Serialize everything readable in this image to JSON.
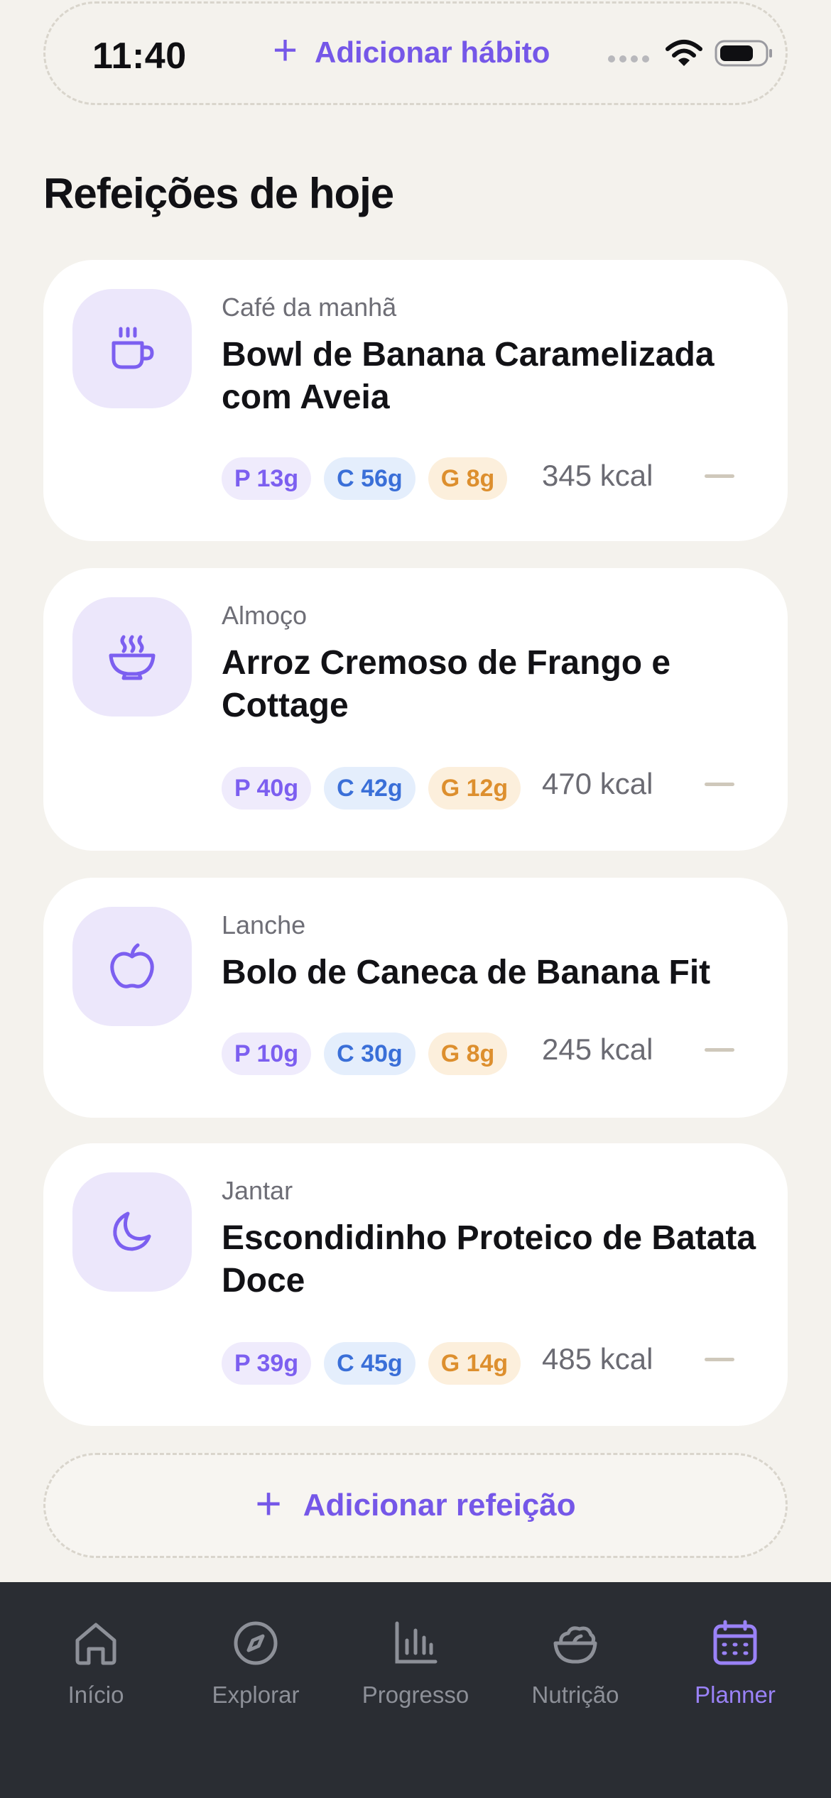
{
  "status_bar": {
    "time": "11:40"
  },
  "top_bar": {
    "add_habit_label": "Adicionar hábito"
  },
  "section": {
    "title": "Refeições de hoje"
  },
  "meals": [
    {
      "label": "Café da manhã",
      "name": "Bowl de Banana Caramelizada com Aveia",
      "protein": "P 13g",
      "carbs": "C 56g",
      "fat": "G 8g",
      "kcal": "345 kcal",
      "icon": "coffee-cup-icon"
    },
    {
      "label": "Almoço",
      "name": "Arroz Cremoso de Frango e Cottage",
      "protein": "P 40g",
      "carbs": "C 42g",
      "fat": "G 12g",
      "kcal": "470 kcal",
      "icon": "soup-bowl-icon"
    },
    {
      "label": "Lanche",
      "name": "Bolo de Caneca de Banana Fit",
      "protein": "P 10g",
      "carbs": "C 30g",
      "fat": "G 8g",
      "kcal": "245 kcal",
      "icon": "apple-icon"
    },
    {
      "label": "Jantar",
      "name": "Escondidinho Proteico de Batata Doce",
      "protein": "P 39g",
      "carbs": "C 45g",
      "fat": "G 14g",
      "kcal": "485 kcal",
      "icon": "moon-icon"
    }
  ],
  "add_meal_label": "Adicionar refeição",
  "nav": [
    {
      "label": "Início",
      "icon": "home-icon",
      "active": false
    },
    {
      "label": "Explorar",
      "icon": "compass-icon",
      "active": false
    },
    {
      "label": "Progresso",
      "icon": "bar-chart-icon",
      "active": false
    },
    {
      "label": "Nutrição",
      "icon": "salad-bowl-icon",
      "active": false
    },
    {
      "label": "Planner",
      "icon": "calendar-icon",
      "active": true
    }
  ],
  "colors": {
    "accent": "#7557e8",
    "background": "#f4f2ed",
    "nav_background": "#2a2d33"
  }
}
